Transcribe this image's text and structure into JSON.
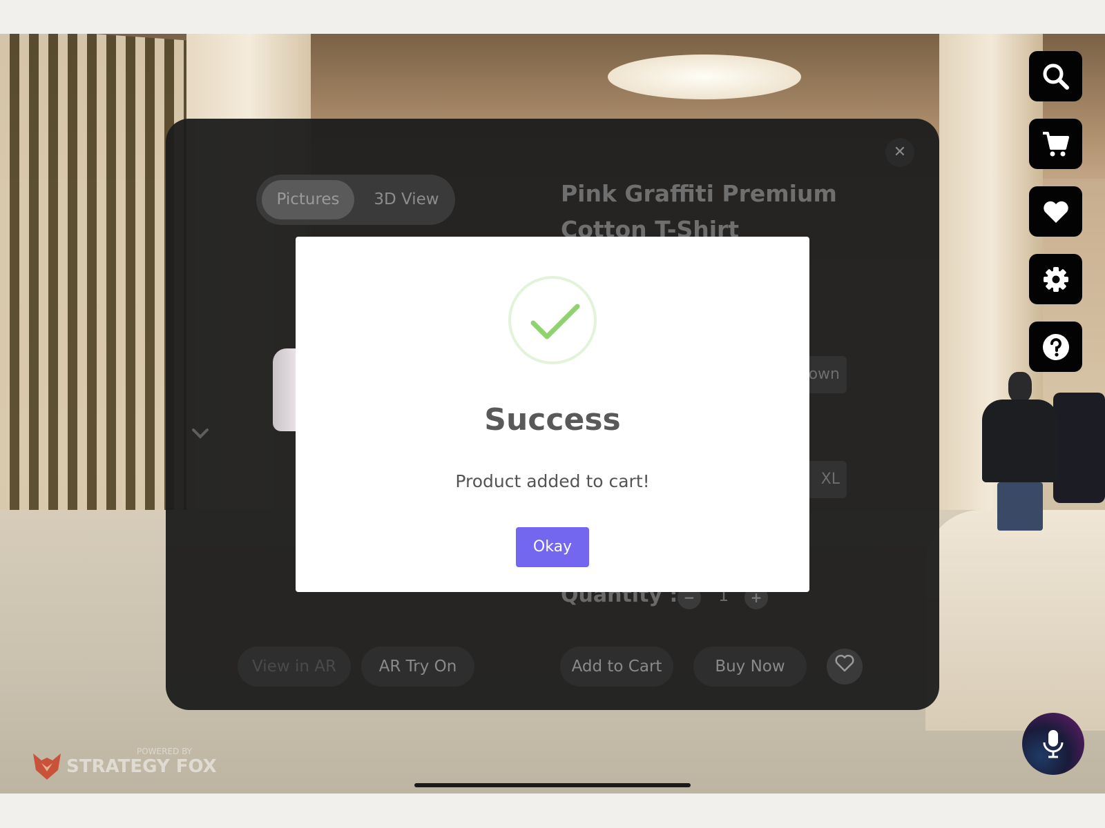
{
  "product": {
    "title": "Pink Graffiti Premium Cotton T-Shirt",
    "view_tabs": [
      "Pictures",
      "3D View"
    ],
    "option_color_partial": "own",
    "option_size_partial": "XL",
    "quantity_label": "Quantity :",
    "quantity_minus": "−",
    "quantity_value": "1",
    "quantity_plus": "+",
    "close_glyph": "✕",
    "actions": {
      "view_in_ar": "View in AR",
      "ar_try_on": "AR Try On",
      "add_to_cart": "Add to Cart",
      "buy_now": "Buy Now"
    }
  },
  "modal": {
    "title": "Success",
    "message": "Product added to cart!",
    "button": "Okay",
    "icon": "check-icon",
    "accent_color": "#7367f0",
    "check_color": "#8fd26e"
  },
  "toolbar": [
    "search-icon",
    "cart-icon",
    "heart-icon",
    "gear-icon",
    "help-icon"
  ],
  "branding": {
    "powered_by": "POWERED BY",
    "name": "STRATEGY FOX"
  }
}
